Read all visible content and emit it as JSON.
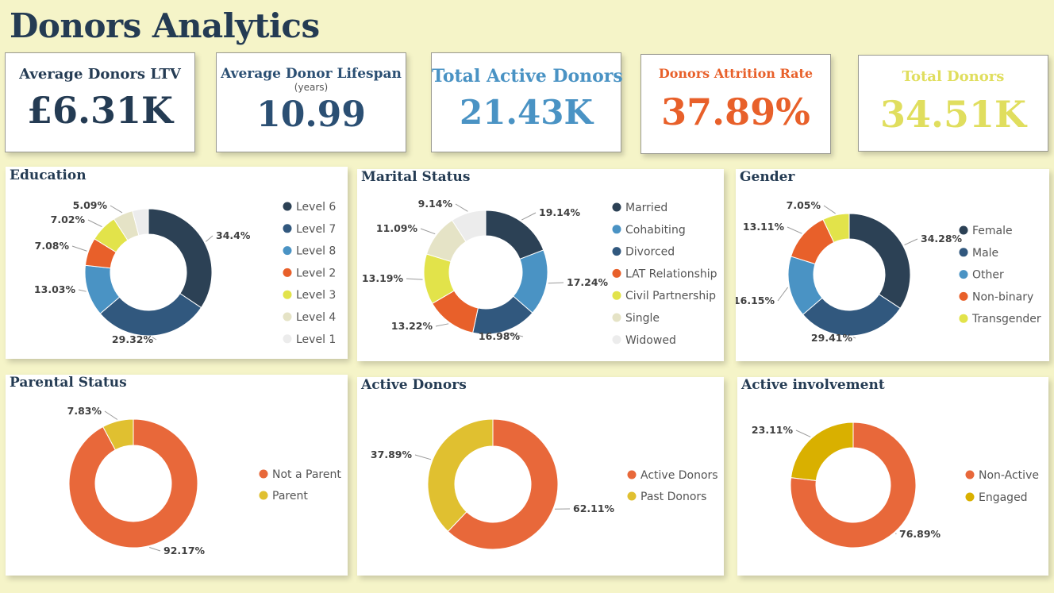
{
  "header": {
    "title": "Donors Analytics"
  },
  "kpis": [
    {
      "label": "Average Donors LTV",
      "sub": "",
      "value": "£6.31K",
      "label_color": "#243b53",
      "value_color": "#243b53"
    },
    {
      "label": "Average Donor Lifespan",
      "sub": "(years)",
      "value": "10.99",
      "label_color": "#2b4f73",
      "value_color": "#2b4f73"
    },
    {
      "label": "Total Active Donors",
      "sub": "",
      "value": "21.43K",
      "label_color": "#4a93c4",
      "value_color": "#4a93c4"
    },
    {
      "label": "Donors Attrition Rate",
      "sub": "",
      "value": "37.89%",
      "label_color": "#e8602a",
      "value_color": "#e8602a"
    },
    {
      "label": "Total Donors",
      "sub": "",
      "value": "34.51K",
      "label_color": "#e0de5e",
      "value_color": "#e0de5e"
    }
  ],
  "chart_data": [
    {
      "type": "pie",
      "title": "Education",
      "legend_position": "right",
      "categories": [
        "Level 6",
        "Level 7",
        "Level 8",
        "Level 2",
        "Level 3",
        "Level 4",
        "Level 1"
      ],
      "values": [
        34.4,
        29.32,
        13.03,
        7.08,
        7.02,
        5.09,
        4.06
      ],
      "labels": [
        "34.4%",
        "29.32%",
        "13.03%",
        "7.08%",
        "7.02%",
        "5.09%",
        ""
      ],
      "colors": [
        "#2c4155",
        "#31587e",
        "#4a93c4",
        "#e8602a",
        "#e2e34a",
        "#e5e3c6",
        "#ececec"
      ]
    },
    {
      "type": "pie",
      "title": "Marital Status",
      "legend_position": "right",
      "categories": [
        "Married",
        "Cohabiting",
        "Divorced",
        "LAT Relationship",
        "Civil Partnership",
        "Single",
        "Widowed"
      ],
      "values": [
        19.14,
        17.24,
        16.98,
        13.22,
        13.19,
        11.09,
        9.14
      ],
      "labels": [
        "19.14%",
        "17.24%",
        "16.98%",
        "13.22%",
        "13.19%",
        "11.09%",
        "9.14%"
      ],
      "colors": [
        "#2c4155",
        "#4a93c4",
        "#31587e",
        "#e8602a",
        "#e2e34a",
        "#e5e3c6",
        "#ececec"
      ]
    },
    {
      "type": "pie",
      "title": "Gender",
      "legend_position": "right",
      "categories": [
        "Female",
        "Male",
        "Other",
        "Non-binary",
        "Transgender"
      ],
      "values": [
        34.28,
        29.41,
        16.15,
        13.11,
        7.05
      ],
      "labels": [
        "34.28%",
        "29.41%",
        "16.15%",
        "13.11%",
        "7.05%"
      ],
      "colors": [
        "#2c4155",
        "#31587e",
        "#4a93c4",
        "#e8602a",
        "#e2e34a"
      ]
    },
    {
      "type": "pie",
      "title": "Parental Status",
      "legend_position": "right",
      "categories": [
        "Not a Parent",
        "Parent"
      ],
      "values": [
        92.17,
        7.83
      ],
      "labels": [
        "92.17%",
        "7.83%"
      ],
      "colors": [
        "#e8683a",
        "#e0c030"
      ]
    },
    {
      "type": "pie",
      "title": "Active Donors",
      "legend_position": "right",
      "categories": [
        "Active Donors",
        "Past Donors"
      ],
      "values": [
        62.11,
        37.89
      ],
      "labels": [
        "62.11%",
        "37.89%"
      ],
      "colors": [
        "#e8683a",
        "#e0c030"
      ]
    },
    {
      "type": "pie",
      "title": "Active involvement",
      "legend_position": "right",
      "categories": [
        "Non-Active",
        "Engaged"
      ],
      "values": [
        76.89,
        23.11
      ],
      "labels": [
        "76.89%",
        "23.11%"
      ],
      "colors": [
        "#e8683a",
        "#d9b000"
      ]
    }
  ]
}
